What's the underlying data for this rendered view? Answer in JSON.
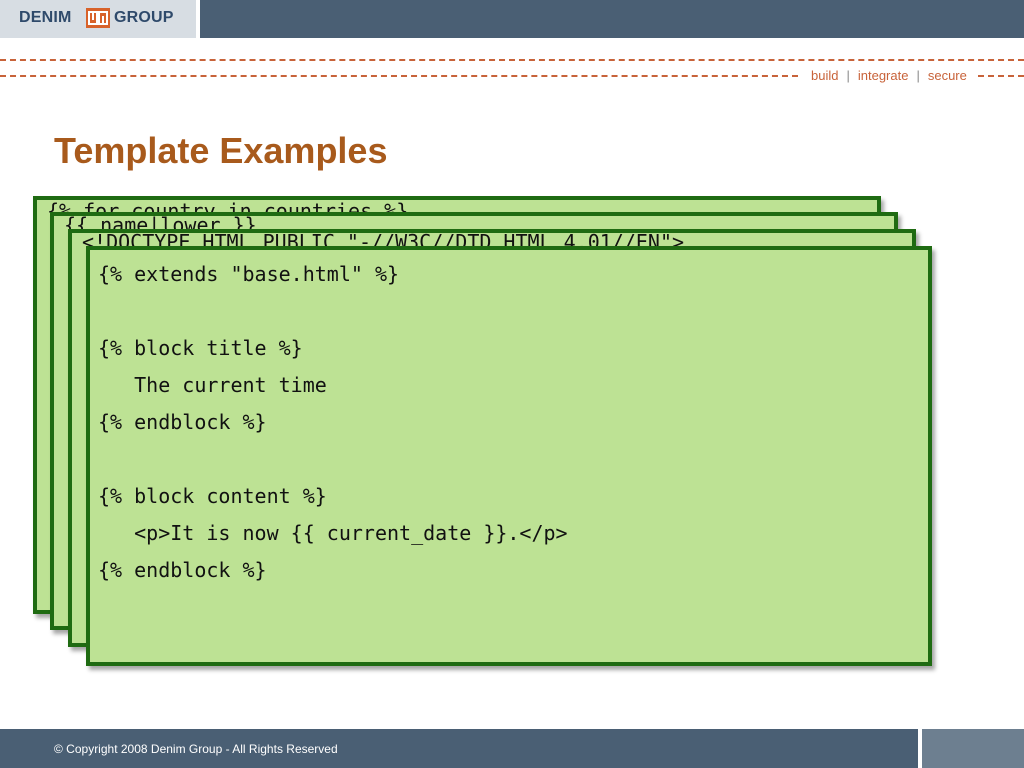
{
  "header": {
    "logo_left": "DENIM",
    "logo_right": "GROUP",
    "logo_icon": "denim-group-logo-icon"
  },
  "tagline": {
    "build": "build",
    "integrate": "integrate",
    "secure": "secure",
    "separator": "|"
  },
  "slide": {
    "title": "Template Examples"
  },
  "cards": {
    "card1": "{% for country in countries %}",
    "card2": "{{ name|lower }}",
    "card3": "<!DOCTYPE HTML PUBLIC \"-//W3C//DTD HTML 4.01//EN\">",
    "card4": "{% extends \"base.html\" %}\n\n{% block title %}\n   The current time\n{% endblock %}\n\n{% block content %}\n   <p>It is now {{ current_date }}.</p>\n{% endblock %}"
  },
  "footer": {
    "copyright": "© Copyright 2008 Denim Group - All Rights Reserved"
  },
  "colors": {
    "header_bar": "#4a5f74",
    "accent_orange": "#c8633a",
    "title_brown": "#a85a1c",
    "card_fill": "#bde294",
    "card_border": "#1f6b12"
  }
}
